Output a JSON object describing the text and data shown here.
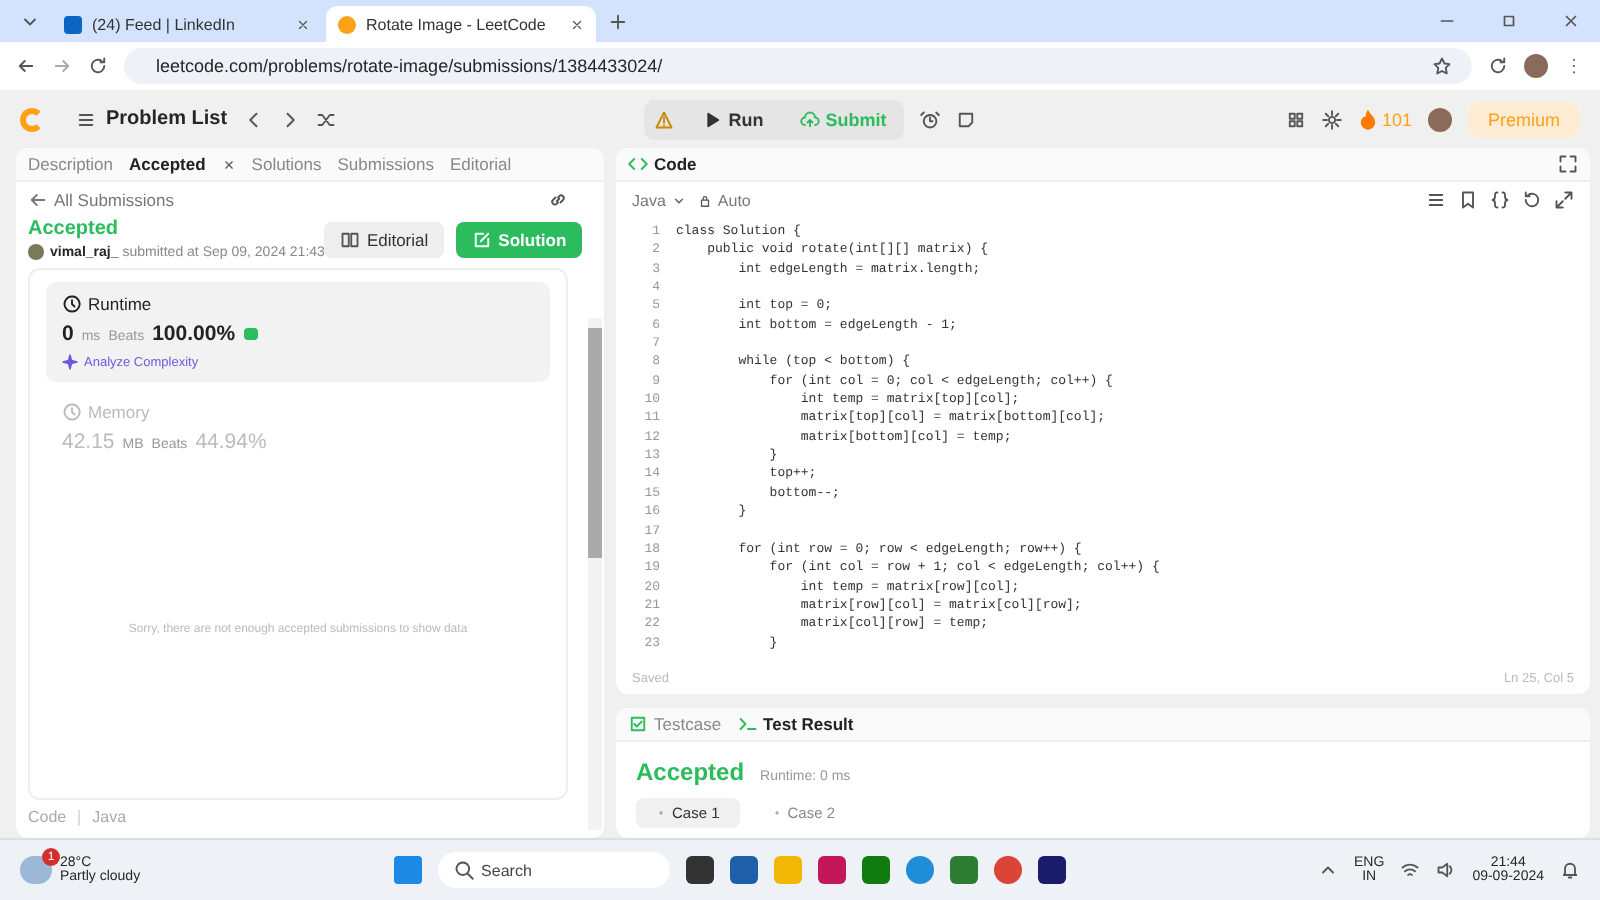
{
  "browser": {
    "tabs": [
      {
        "title": "(24) Feed | LinkedIn",
        "selected": false
      },
      {
        "title": "Rotate Image - LeetCode",
        "selected": true
      }
    ],
    "address": "leetcode.com/problems/rotate-image/submissions/1384433024/"
  },
  "header": {
    "problem_list": "Problem List",
    "run": "Run",
    "submit": "Submit",
    "streak": "101",
    "premium": "Premium"
  },
  "left_panel": {
    "tabs": [
      {
        "label": "Description",
        "selected": false,
        "closable": false
      },
      {
        "label": "Accepted",
        "selected": true,
        "closable": true
      },
      {
        "label": "Solutions",
        "selected": false,
        "closable": false
      },
      {
        "label": "Submissions",
        "selected": false,
        "closable": false
      },
      {
        "label": "Editorial",
        "selected": false,
        "closable": false
      }
    ],
    "back_link": "All Submissions",
    "status": "Accepted",
    "user": "vimal_raj_",
    "submitted": "submitted at Sep 09, 2024 21:43",
    "buttons": [
      "Editorial",
      "Solution"
    ],
    "stats": [
      {
        "title": "Runtime",
        "value": "0",
        "unit": "ms",
        "beats_label": "Beats",
        "beats": "100.00%",
        "selected": true,
        "link": "Analyze Complexity"
      },
      {
        "title": "Memory",
        "value": "42.15",
        "unit": "MB",
        "beats_label": "Beats",
        "beats": "44.94%",
        "selected": false
      }
    ],
    "empty_message": "Sorry, there are not enough accepted submissions to show data",
    "footer": [
      "Code",
      "Java"
    ]
  },
  "editor": {
    "title": "Code",
    "language": "Java",
    "mode": "Auto",
    "lines": [
      {
        "n": "1",
        "code": "class Solution {"
      },
      {
        "n": "2",
        "code": "    public void rotate(int[][] matrix) {"
      },
      {
        "n": "3",
        "code": "        int edgeLength = matrix.length;"
      },
      {
        "n": "4"
      },
      {
        "n": "5",
        "code": "        int top = 0;"
      },
      {
        "n": "6",
        "code": "        int bottom = edgeLength - 1;"
      },
      {
        "n": "7"
      },
      {
        "n": "8",
        "code": "        while (top < bottom) {"
      },
      {
        "n": "9",
        "code": "            for (int col = 0; col < edgeLength; col++) {"
      },
      {
        "n": "10",
        "code": "                int temp = matrix[top][col];"
      },
      {
        "n": "11",
        "code": "                matrix[top][col] = matrix[bottom][col];"
      },
      {
        "n": "12",
        "code": "                matrix[bottom][col] = temp;"
      },
      {
        "n": "13",
        "code": "            }"
      },
      {
        "n": "14",
        "code": "            top++;"
      },
      {
        "n": "15",
        "code": "            bottom--;"
      },
      {
        "n": "16",
        "code": "        }"
      },
      {
        "n": "17"
      },
      {
        "n": "18",
        "code": "        for (int row = 0; row < edgeLength; row++) {"
      },
      {
        "n": "19",
        "code": "            for (int col = row + 1; col < edgeLength; col++) {"
      },
      {
        "n": "20",
        "code": "                int temp = matrix[row][col];"
      },
      {
        "n": "21",
        "code": "                matrix[row][col] = matrix[col][row];"
      },
      {
        "n": "22",
        "code": "                matrix[col][row] = temp;"
      },
      {
        "n": "23",
        "code": "            }"
      }
    ],
    "saved": "Saved",
    "cursor": "Ln 25, Col 5"
  },
  "console": {
    "tabs": [
      {
        "label": "Testcase",
        "selected": false
      },
      {
        "label": "Test Result",
        "selected": true
      }
    ],
    "status": "Accepted",
    "runtime": "Runtime: 0 ms",
    "cases": [
      {
        "label": "Case 1",
        "selected": true
      },
      {
        "label": "Case 2",
        "selected": false
      }
    ]
  },
  "taskbar": {
    "weather_badge": "1",
    "temperature": "28°C",
    "weather": "Partly cloudy",
    "search": "Search",
    "lang": "ENG",
    "region": "IN",
    "time": "21:44",
    "date": "09-09-2024"
  }
}
